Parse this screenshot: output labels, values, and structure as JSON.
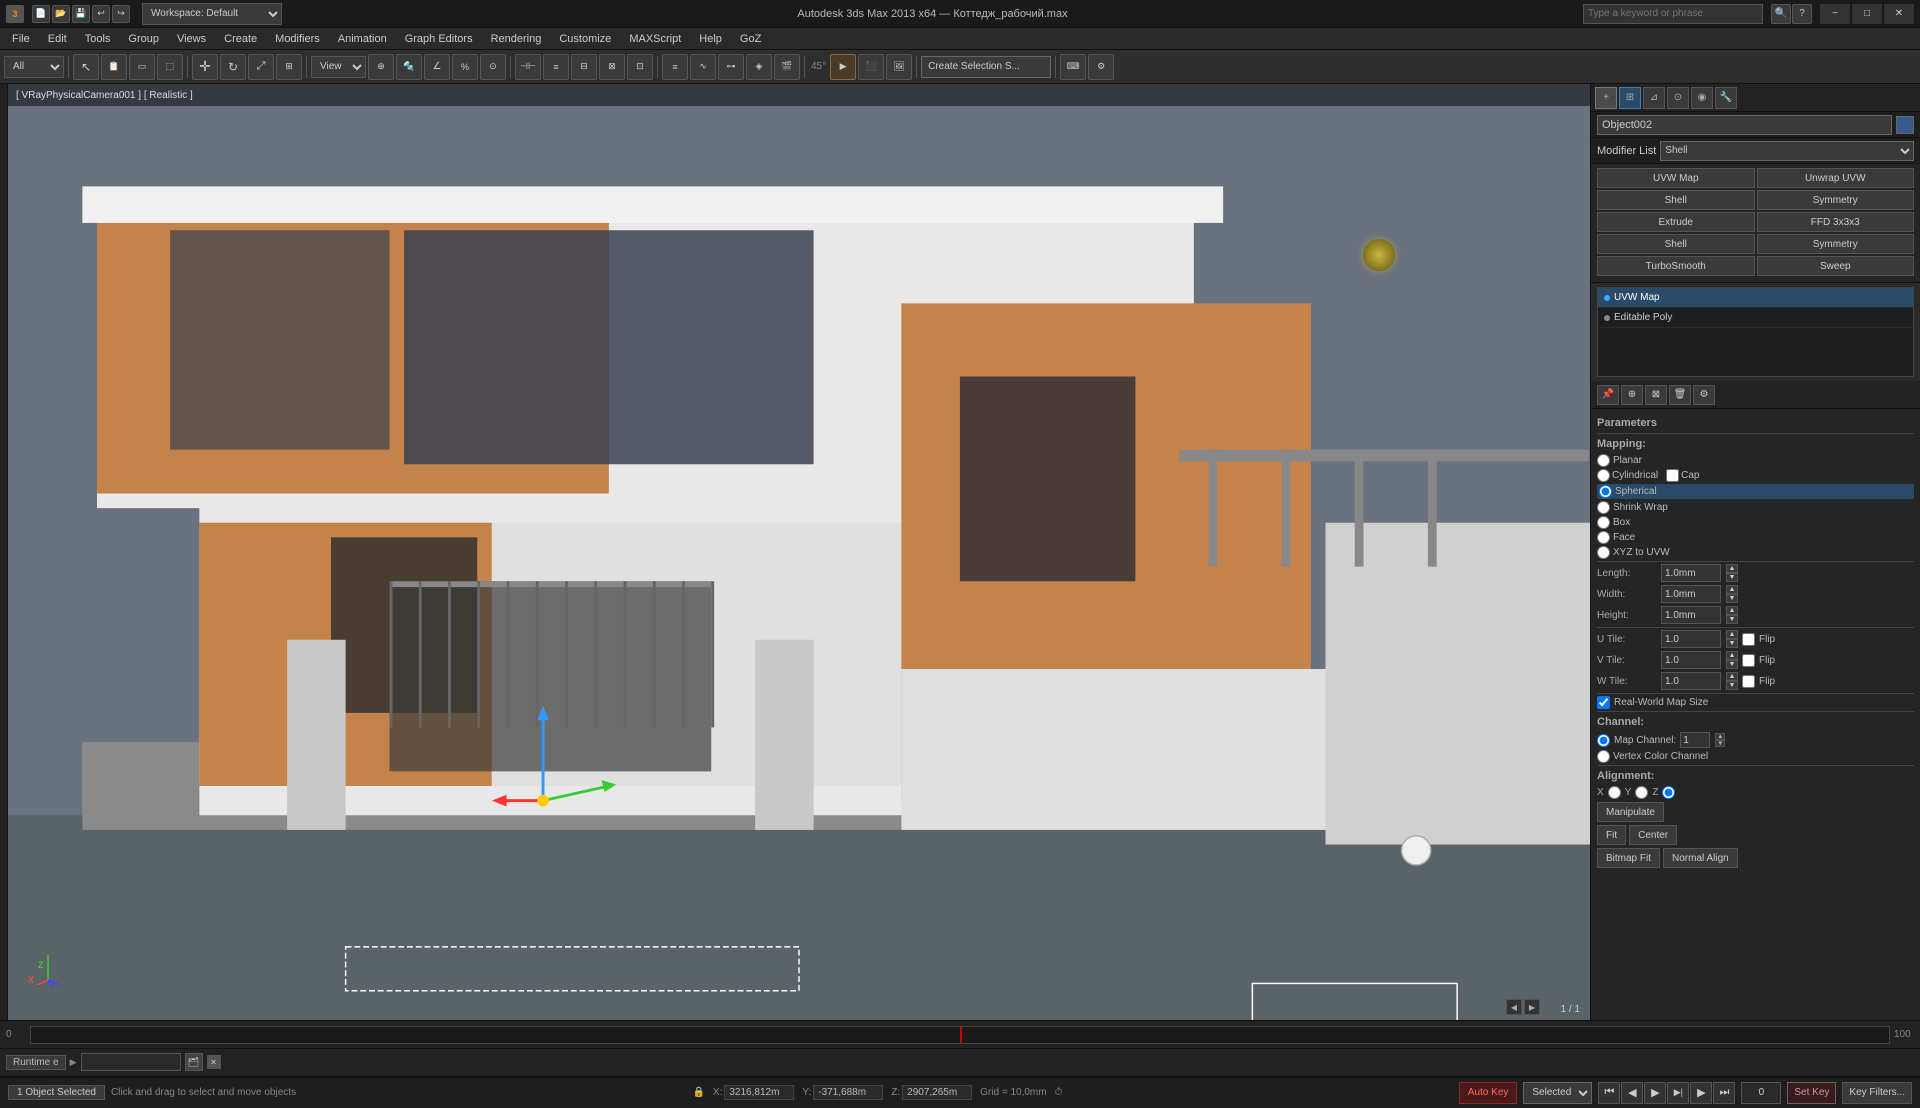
{
  "titleBar": {
    "appTitle": "Autodesk 3ds Max 2013 x64 — Коттедж_рабочий.max",
    "workspaceName": "Workspace: Default",
    "minBtn": "−",
    "maxBtn": "□",
    "closeBtn": "✕"
  },
  "menuBar": {
    "items": [
      {
        "id": "file",
        "label": "File"
      },
      {
        "id": "edit",
        "label": "Edit"
      },
      {
        "id": "tools",
        "label": "Tools"
      },
      {
        "id": "group",
        "label": "Group"
      },
      {
        "id": "views",
        "label": "Views"
      },
      {
        "id": "create",
        "label": "Create"
      },
      {
        "id": "modifiers",
        "label": "Modifiers"
      },
      {
        "id": "animation",
        "label": "Animation"
      },
      {
        "id": "graph-editors",
        "label": "Graph Editors"
      },
      {
        "id": "rendering",
        "label": "Rendering"
      },
      {
        "id": "customize",
        "label": "Customize"
      },
      {
        "id": "maxscript",
        "label": "MAXScript"
      },
      {
        "id": "help",
        "label": "Help"
      },
      {
        "id": "goz",
        "label": "GoZ"
      }
    ]
  },
  "viewport": {
    "label": "[ VRayPhysicalCamera001 ] [ Realistic ]",
    "frames": "1 / 1"
  },
  "rightPanel": {
    "objectName": "Object002",
    "modifierListLabel": "Modifier List",
    "modifiers": {
      "row1": [
        "UVW Map",
        "Unwrap UVW"
      ],
      "row2": [
        "Shell",
        "Symmetry"
      ],
      "row3": [
        "Extrude",
        "FFD 3x3x3"
      ],
      "row4": [
        "Shell",
        "Symmetry"
      ],
      "row5": [
        "TurboSmooth",
        "Sweep"
      ]
    },
    "stackItems": [
      {
        "label": "UVW Map",
        "selected": true,
        "hasExpand": false
      },
      {
        "label": "Editable Poly",
        "selected": false,
        "hasExpand": false
      }
    ],
    "parameters": {
      "title": "Parameters",
      "mappingTitle": "Mapping:",
      "mappingOptions": [
        "Planar",
        "Cylindrical",
        "Cap",
        "Spherical",
        "Shrink Wrap",
        "Box",
        "Face",
        "XYZ to UVW"
      ],
      "selectedMapping": "Spherical",
      "lengthLabel": "Length:",
      "lengthValue": "1.0mm",
      "widthLabel": "Width:",
      "widthValue": "1.0mm",
      "heightLabel": "Height:",
      "heightValue": "1.0mm",
      "uTileLabel": "U Tile:",
      "uTileValue": "1.0",
      "vTileLabel": "V Tile:",
      "vTileValue": "1.0",
      "wTileLabel": "W Tile:",
      "wTileValue": "1.0",
      "flipLabel": "Flip",
      "realWorldLabel": "Real-World Map Size",
      "channelTitle": "Channel:",
      "mapChannelLabel": "Map Channel:",
      "mapChannelValue": "1",
      "vertexColorChannelLabel": "Vertex Color Channel",
      "alignmentTitle": "Alignment:",
      "xLabel": "X",
      "yLabel": "Y",
      "zLabel": "Z",
      "manipulateLabel": "Manipulate",
      "fitLabel": "Fit",
      "centerLabel": "Center",
      "bitmapFitLabel": "Bitmap Fit",
      "normalAlignLabel": "Normal Align"
    }
  },
  "statusBar": {
    "objectSelected": "1 Object Selected",
    "clickAndDrag": "Click and drag to select and move objects",
    "xLabel": "X:",
    "xValue": "3216,812m",
    "yLabel": "Y:",
    "yValue": "-371,688m",
    "zLabel": "Z:",
    "zValue": "2907,265m",
    "gridLabel": "Grid = 10,0mm",
    "autoKeyLabel": "Auto Key",
    "selectedLabel": "Selected",
    "setKeyLabel": "Set Key",
    "keyFiltersLabel": "Key Filters..."
  },
  "timeline": {
    "currentFrame": "0",
    "frameRange": "1 / 1"
  },
  "icons": {
    "undo": "↩",
    "redo": "↪",
    "save": "💾",
    "select": "↖",
    "move": "✛",
    "rotate": "↻",
    "scale": "⤢",
    "camera": "📷",
    "light": "💡",
    "render": "▶",
    "play": "▶",
    "stop": "⏹",
    "prev": "⏮",
    "next": "⏭",
    "key": "🔑",
    "lock": "🔒",
    "pin": "📌",
    "close": "✕",
    "minimize": "−",
    "maximize": "□",
    "checkmark": "✓",
    "expand": "▶",
    "dot": "●"
  }
}
